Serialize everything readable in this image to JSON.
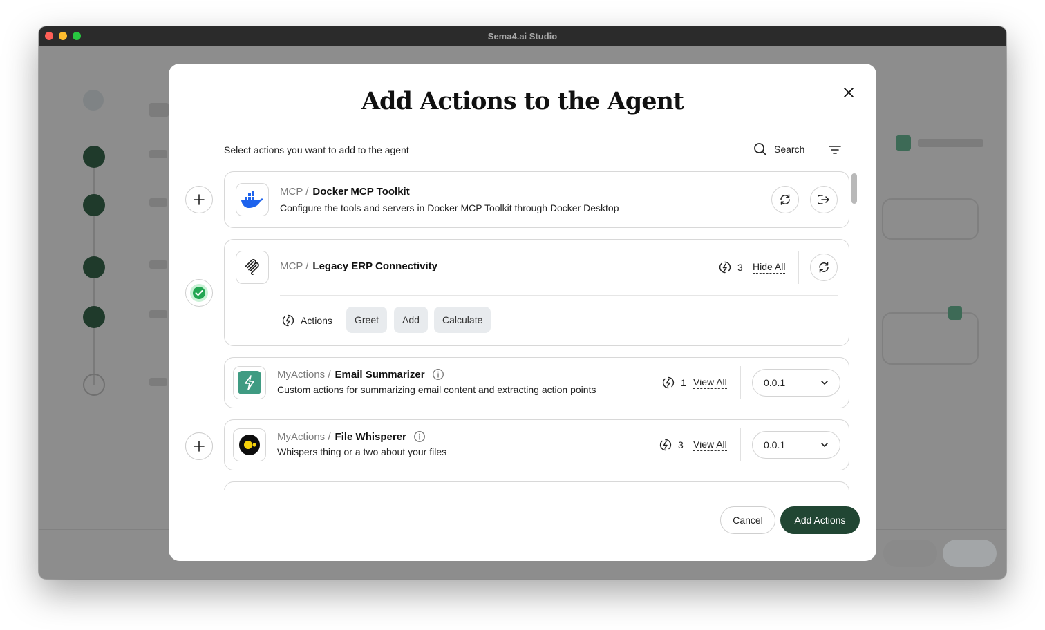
{
  "window": {
    "title": "Sema4.ai Studio"
  },
  "modal": {
    "title": "Add Actions to the Agent",
    "subtitle": "Select actions you want to add to the agent",
    "search_label": "Search",
    "cancel_label": "Cancel",
    "primary_label": "Add Actions"
  },
  "actions": [
    {
      "prefix": "MCP /",
      "name": "Docker MCP Toolkit",
      "description": "Configure the tools and servers in Docker MCP Toolkit through Docker Desktop",
      "selected": false,
      "logo_icon": "docker-whale-icon"
    },
    {
      "prefix": "MCP /",
      "name": "Legacy ERP Connectivity",
      "count": "3",
      "toggle_label": "Hide All",
      "actions_label": "Actions",
      "chips": [
        "Greet",
        "Add",
        "Calculate"
      ],
      "selected": true,
      "logo_icon": "mcp-logo-icon"
    },
    {
      "prefix": "MyActions /",
      "name": "Email Summarizer",
      "description": "Custom actions for summarizing email content and extracting action points",
      "count": "1",
      "toggle_label": "View All",
      "version": "0.0.1",
      "selected": false,
      "logo_icon": "lightning-logo-icon"
    },
    {
      "prefix": "MyActions /",
      "name": "File Whisperer",
      "description": "Whispers thing or a two about your files",
      "count": "3",
      "toggle_label": "View All",
      "version": "0.0.1",
      "selected": false,
      "logo_icon": "whisperer-logo-icon"
    }
  ],
  "colors": {
    "primary": "#214633",
    "selected": "#22a652",
    "accent_teal": "#3f9b82",
    "docker_blue": "#1d63ed"
  }
}
